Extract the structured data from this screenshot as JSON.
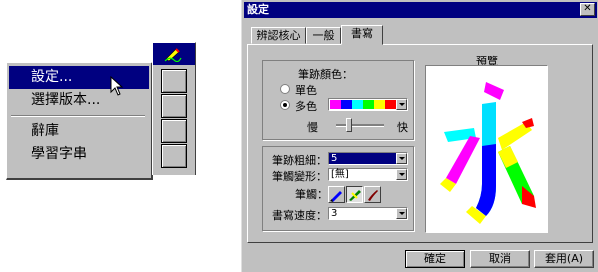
{
  "context_menu": {
    "items": [
      {
        "label": "設定..."
      },
      {
        "label": "選擇版本..."
      },
      {
        "label": "辭庫"
      },
      {
        "label": "學習字串"
      }
    ]
  },
  "dialog": {
    "title": "設定",
    "close_glyph": "✕",
    "tabs": [
      {
        "label": "辨認核心"
      },
      {
        "label": "一般"
      },
      {
        "label": "書寫"
      }
    ],
    "pen_color_label": "筆跡顏色：",
    "single_color_label": "單色",
    "multi_color_label": "多色",
    "slow_label": "慢",
    "fast_label": "快",
    "pen_width_label": "筆跡粗細：",
    "pen_width_value": "5",
    "pen_shape_label": "筆觸變形：",
    "pen_shape_value": "[無]",
    "brush_label": "筆觸：",
    "write_speed_label": "書寫速度：",
    "write_speed_value": "3",
    "preview_label": "預覽",
    "preview_char": "永",
    "palette": [
      "#ff00ff",
      "#0000ff",
      "#00ffff",
      "#00ff00",
      "#ffff00",
      "#ff0000"
    ],
    "buttons": {
      "ok": "確定",
      "cancel": "取消",
      "apply": "套用(A)"
    }
  }
}
